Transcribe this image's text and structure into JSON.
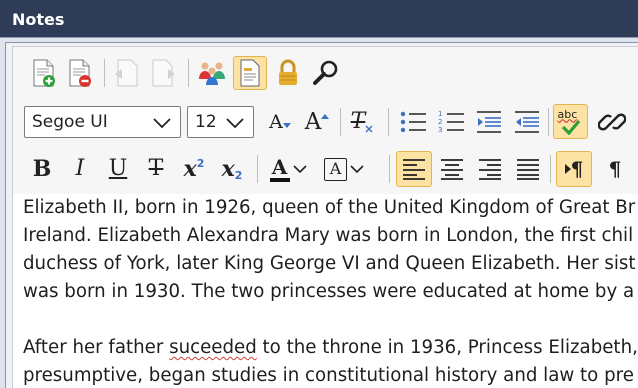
{
  "window": {
    "title": "Notes"
  },
  "toolbar": {
    "font_family": "Segoe UI",
    "font_size": "12",
    "bold_label": "B",
    "italic_label": "I",
    "underline_label": "U",
    "strike_label": "T",
    "superscript_base": "x",
    "superscript_exp": "2",
    "subscript_base": "x",
    "subscript_exp": "2",
    "spellcheck_label": "abc",
    "grow_font_label": "A",
    "shrink_font_label": "A",
    "clear_format_label": "T",
    "font_color_label": "A",
    "highlight_label": "A",
    "pilcrow_label": "¶",
    "pilcrow2_label": "¶",
    "accent_color": "#fce3a3"
  },
  "document": {
    "lines": [
      "Elizabeth II, born in 1926, queen of the United Kingdom of Great Br",
      "Ireland. Elizabeth Alexandra Mary was born in London, the first chil",
      "duchess of York, later King George VI and Queen Elizabeth. Her sist",
      "was born in 1930. The two princesses were educated at home by a",
      "",
      "presumptive, began studies in constitutional history and law to pre"
    ],
    "line5_before": "After her father ",
    "line5_misspelled": "suceeded",
    "line5_after": " to the throne in 1936, Princess Elizabeth,"
  }
}
